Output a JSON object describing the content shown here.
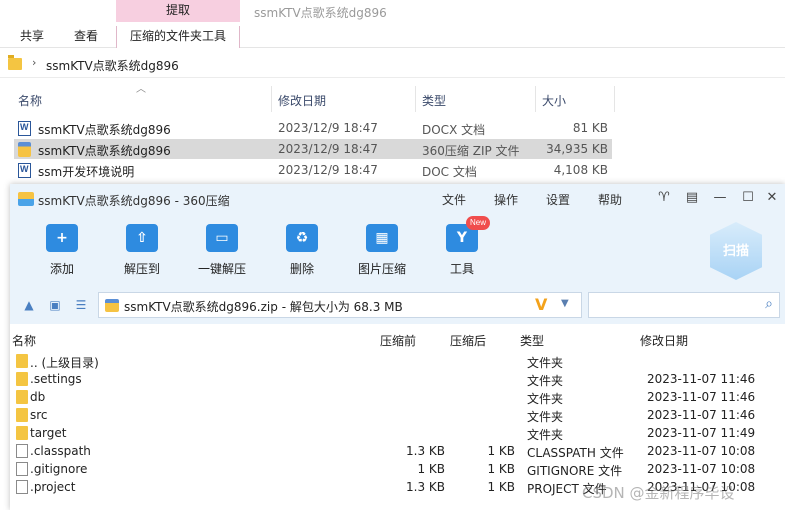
{
  "explorer": {
    "context_tab": "提取",
    "title": "ssmKTV点歌系统dg896",
    "tabs": [
      "共享",
      "查看",
      "压缩的文件夹工具"
    ],
    "address": "ssmKTV点歌系统dg896",
    "columns": [
      "名称",
      "修改日期",
      "类型",
      "大小"
    ],
    "files": [
      {
        "name": "ssmKTV点歌系统dg896",
        "date": "2023/12/9 18:47",
        "type": "DOCX 文档",
        "size": "81 KB",
        "icon": "word-doc-icon"
      },
      {
        "name": "ssmKTV点歌系统dg896",
        "date": "2023/12/9 18:47",
        "type": "360压缩 ZIP 文件",
        "size": "34,935 KB",
        "icon": "zip-icon"
      },
      {
        "name": "ssm开发环境说明",
        "date": "2023/12/9 18:47",
        "type": "DOC 文档",
        "size": "4,108 KB",
        "icon": "word-doc-icon"
      }
    ]
  },
  "zip": {
    "title": "ssmKTV点歌系统dg896 - 360压缩",
    "menu": [
      "文件",
      "操作",
      "设置",
      "帮助"
    ],
    "tools": [
      "添加",
      "解压到",
      "一键解压",
      "删除",
      "图片压缩",
      "工具"
    ],
    "tool_icons": [
      "+",
      "⇧",
      "▭",
      "♻",
      "▦",
      "Y"
    ],
    "new_badge": "New",
    "scan": "扫描",
    "path": "ssmKTV点歌系统dg896.zip - 解包大小为 68.3 MB",
    "columns": [
      "名称",
      "压缩前",
      "压缩后",
      "类型",
      "修改日期"
    ],
    "rows": [
      {
        "name": ".. (上级目录)",
        "before": "",
        "after": "",
        "type": "文件夹",
        "date": "",
        "icon": "folder"
      },
      {
        "name": ".settings",
        "before": "",
        "after": "",
        "type": "文件夹",
        "date": "2023-11-07 11:46",
        "icon": "folder"
      },
      {
        "name": "db",
        "before": "",
        "after": "",
        "type": "文件夹",
        "date": "2023-11-07 11:46",
        "icon": "folder"
      },
      {
        "name": "src",
        "before": "",
        "after": "",
        "type": "文件夹",
        "date": "2023-11-07 11:46",
        "icon": "folder"
      },
      {
        "name": "target",
        "before": "",
        "after": "",
        "type": "文件夹",
        "date": "2023-11-07 11:49",
        "icon": "folder"
      },
      {
        "name": ".classpath",
        "before": "1.3 KB",
        "after": "1 KB",
        "type": "CLASSPATH 文件",
        "date": "2023-11-07 10:08",
        "icon": "file"
      },
      {
        "name": ".gitignore",
        "before": "1 KB",
        "after": "1 KB",
        "type": "GITIGNORE 文件",
        "date": "2023-11-07 10:08",
        "icon": "file"
      },
      {
        "name": ".project",
        "before": "1.3 KB",
        "after": "1 KB",
        "type": "PROJECT 文件",
        "date": "2023-11-07 10:08",
        "icon": "file"
      }
    ]
  },
  "watermark": "CSDN @金新程序毕设"
}
